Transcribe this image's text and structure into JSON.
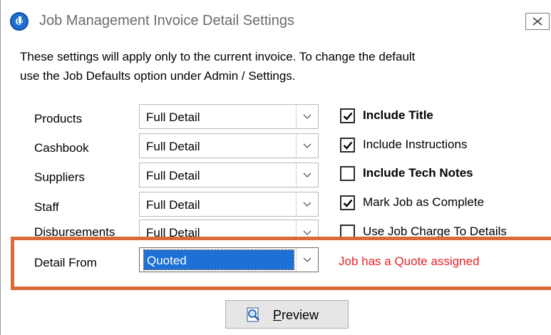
{
  "window": {
    "title": "Job Management Invoice Detail Settings",
    "close_icon": "close-icon"
  },
  "intro": {
    "line1": "These settings will apply only to the current invoice.  To change the default",
    "line2": "use the Job Defaults option under Admin / Settings."
  },
  "rows": [
    {
      "label": "Products",
      "value": "Full Detail"
    },
    {
      "label": "Cashbook",
      "value": "Full Detail"
    },
    {
      "label": "Suppliers",
      "value": "Full Detail"
    },
    {
      "label": "Staff",
      "value": "Full Detail"
    },
    {
      "label": "Disbursements",
      "value": "Full Detail"
    },
    {
      "label": "Detail From",
      "value": "Quoted"
    }
  ],
  "options": [
    {
      "label": "Include Title",
      "checked": true,
      "bold": true
    },
    {
      "label": "Include Instructions",
      "checked": true,
      "bold": false
    },
    {
      "label": "Include Tech Notes",
      "checked": false,
      "bold": true
    },
    {
      "label": "Mark Job as Complete",
      "checked": true,
      "bold": false
    },
    {
      "label": "Use Job Charge To Details",
      "checked": false,
      "bold": false
    }
  ],
  "status": {
    "message": "Job has a Quote assigned",
    "color": "#e8232a"
  },
  "preview": {
    "label": "Preview",
    "icon": "magnifier-page-icon"
  },
  "colors": {
    "highlight_border": "#d96a3a",
    "selection": "#1c70d6"
  }
}
